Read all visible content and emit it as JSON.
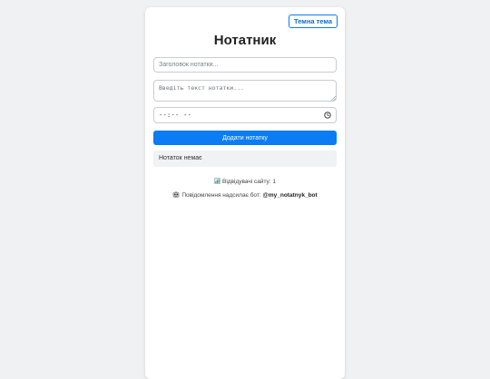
{
  "header": {
    "theme_button_label": "Темна тема",
    "title": "Нотатник"
  },
  "form": {
    "title_placeholder": "Заголовок нотатки...",
    "text_placeholder": "Введіть текст нотатки...",
    "time_value": "--:-- --",
    "add_button_label": "Додати нотатку"
  },
  "notes": {
    "empty_message": "Нотаток немає"
  },
  "footer": {
    "visits_text": "Відвідувачі сайту: 1",
    "bot_text": "Повідомлення надсилає бот:",
    "bot_handle": "@my_notatnyk_bot"
  },
  "colors": {
    "accent": "#0b7cf3",
    "page_background": "#f0f1f3",
    "card_background": "#ffffff"
  },
  "icons": {
    "time": "clock-icon",
    "visits": "stats-icon",
    "bot": "robot-icon"
  }
}
